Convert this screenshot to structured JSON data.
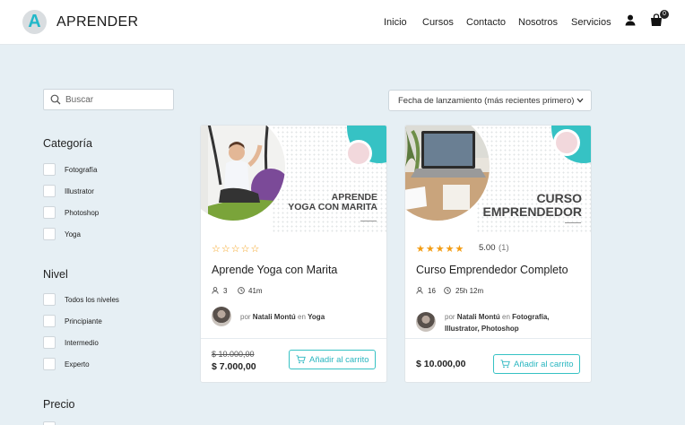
{
  "brand": {
    "letter": "A",
    "name": "APRENDER"
  },
  "nav": {
    "items": [
      "Inicio",
      "Cursos",
      "Contacto",
      "Nosotros",
      "Servicios"
    ],
    "cart_count": "0"
  },
  "search": {
    "placeholder": "Buscar"
  },
  "sort": {
    "selected": "Fecha de lanzamiento (más recientes primero)"
  },
  "sidebar": {
    "category_title": "Categoría",
    "categories": [
      "Fotografía",
      "Illustrator",
      "Photoshop",
      "Yoga"
    ],
    "level_title": "Nivel",
    "levels": [
      "Todos los niveles",
      "Principiante",
      "Intermedio",
      "Experto"
    ],
    "price_title": "Precio"
  },
  "colors": {
    "accent": "#36c2c4",
    "star": "#f39c12"
  },
  "courses": [
    {
      "image_title_line1": "APRENDE",
      "image_title_line2": "YOGA CON MARITA",
      "title": "Aprende Yoga con Marita",
      "rating": null,
      "students": "3",
      "duration": "41m",
      "by": "por",
      "author": "Natali Montú",
      "in": "en",
      "categories": "Yoga",
      "old_price": "$ 10.000,00",
      "price": "$ 7.000,00",
      "cart_label": "Añadir al carrito"
    },
    {
      "image_title_line1": "CURSO",
      "image_title_line2": "EMPRENDEDOR",
      "title": "Curso Emprendedor Completo",
      "rating": "5.00",
      "rating_count": "(1)",
      "students": "16",
      "duration": "25h 12m",
      "by": "por",
      "author": "Natali Montú",
      "in": "en",
      "categories_line1": "Fotografía,",
      "categories_line2": "Illustrator, Photoshop",
      "price": "$ 10.000,00",
      "cart_label": "Añadir al carrito"
    }
  ]
}
